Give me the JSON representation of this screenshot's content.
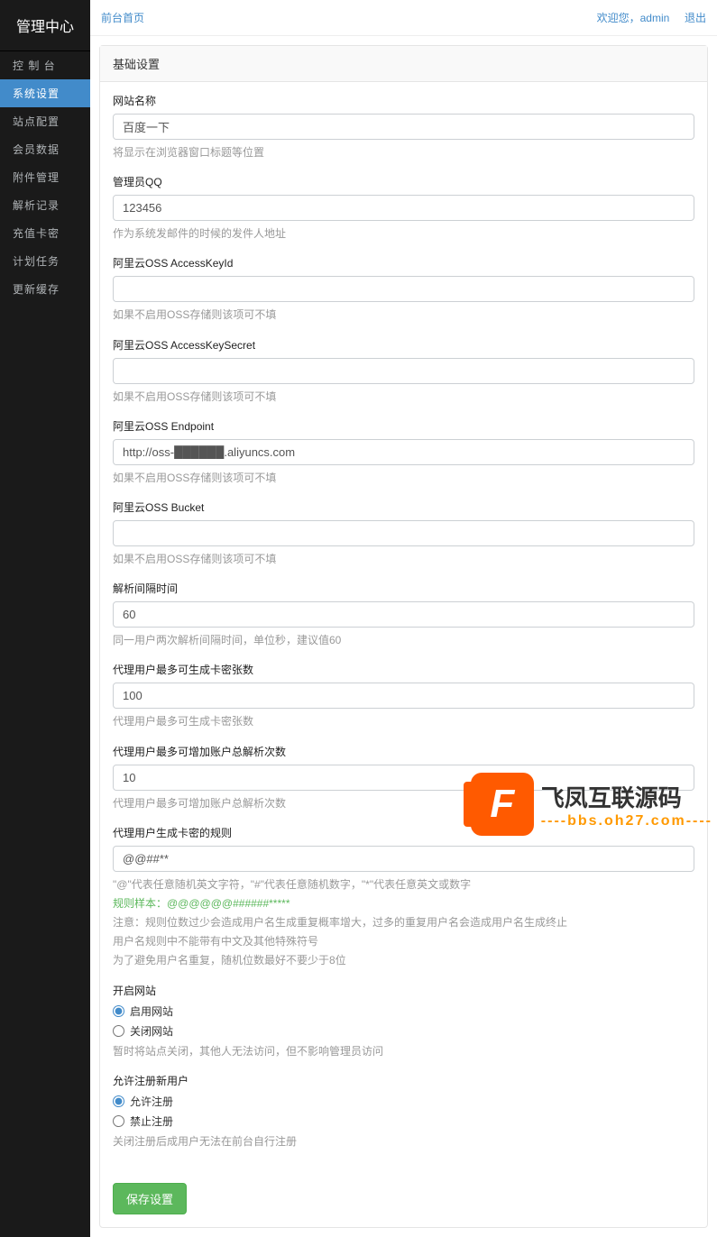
{
  "brand": "管理中心",
  "sidebar": {
    "items": [
      {
        "label": "控 制 台"
      },
      {
        "label": "系统设置"
      },
      {
        "label": "站点配置"
      },
      {
        "label": "会员数据"
      },
      {
        "label": "附件管理"
      },
      {
        "label": "解析记录"
      },
      {
        "label": "充值卡密"
      },
      {
        "label": "计划任务"
      },
      {
        "label": "更新缓存"
      }
    ],
    "activeIndex": 1
  },
  "topbar": {
    "home": "前台首页",
    "welcome": "欢迎您，",
    "user": "admin",
    "logout": "退出"
  },
  "panelTitle": "基础设置",
  "fields": {
    "siteName": {
      "label": "网站名称",
      "value": "百度一下",
      "help": "将显示在浏览器窗口标题等位置"
    },
    "adminQQ": {
      "label": "管理员QQ",
      "value": "123456",
      "help": "作为系统发邮件的时候的发件人地址"
    },
    "ossKeyId": {
      "label": "阿里云OSS AccessKeyId",
      "value": "",
      "help": "如果不启用OSS存储则该项可不填"
    },
    "ossSecret": {
      "label": "阿里云OSS AccessKeySecret",
      "value": "",
      "help": "如果不启用OSS存储则该项可不填"
    },
    "ossEndpoint": {
      "label": "阿里云OSS Endpoint",
      "value": "http://oss-██████.aliyuncs.com",
      "help": "如果不启用OSS存储则该项可不填"
    },
    "ossBucket": {
      "label": "阿里云OSS Bucket",
      "value": "",
      "help": "如果不启用OSS存储则该项可不填"
    },
    "interval": {
      "label": "解析间隔时间",
      "value": "60",
      "help": "同一用户两次解析间隔时间，单位秒，建议值60"
    },
    "maxCards": {
      "label": "代理用户最多可生成卡密张数",
      "value": "100",
      "help": "代理用户最多可生成卡密张数"
    },
    "maxParse": {
      "label": "代理用户最多可增加账户总解析次数",
      "value": "10",
      "help": "代理用户最多可增加账户总解析次数"
    },
    "cardRule": {
      "label": "代理用户生成卡密的规则",
      "value": "@@##**",
      "help1": "\"@\"代表任意随机英文字符，\"#\"代表任意随机数字，\"*\"代表任意英文或数字",
      "help2": "规则样本：@@@@@@######*****",
      "help3": "注意：规则位数过少会造成用户名生成重复概率增大，过多的重复用户名会造成用户名生成终止",
      "help4": "用户名规则中不能带有中文及其他特殊符号",
      "help5": "为了避免用户名重复，随机位数最好不要少于8位"
    },
    "siteOpen": {
      "label": "开启网站",
      "opt1": "启用网站",
      "opt2": "关闭网站",
      "help": "暂时将站点关闭，其他人无法访问，但不影响管理员访问"
    },
    "allowReg": {
      "label": "允许注册新用户",
      "opt1": "允许注册",
      "opt2": "禁止注册",
      "help": "关闭注册后成用户无法在前台自行注册"
    }
  },
  "saveBtn": "保存设置",
  "watermark": {
    "title": "飞凤互联源码",
    "url": "----bbs.oh27.com----"
  }
}
